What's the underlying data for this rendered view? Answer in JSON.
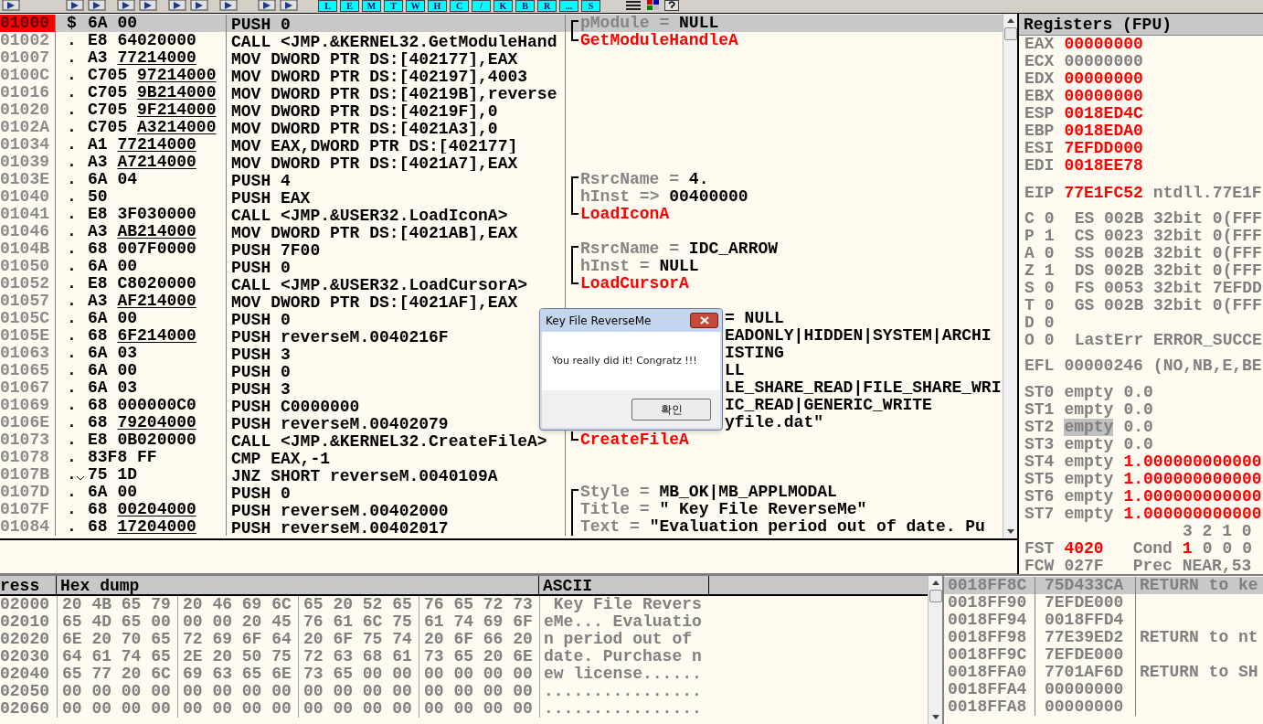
{
  "toolbar": {
    "buttons": [
      "L",
      "E",
      "M",
      "T",
      "W",
      "H",
      "C",
      "/",
      "K",
      "B",
      "R",
      "...",
      "S"
    ]
  },
  "disassembly": {
    "rows": [
      {
        "address": "01000",
        "marker": "$",
        "jump": false,
        "opcode": "6A",
        "operand": "00",
        "underlined": false,
        "instruction": "PUSH 0",
        "selected": true,
        "comment": {
          "kind": "param",
          "opens_group": true,
          "closes_group": false,
          "name": "pModule",
          "op": "=",
          "value": "NULL"
        }
      },
      {
        "address": "01002",
        "marker": ".",
        "jump": false,
        "opcode": "E8",
        "operand": "64020000",
        "underlined": false,
        "instruction": "CALL <JMP.&KERNEL32.GetModuleHand",
        "selected": false,
        "comment": {
          "kind": "call",
          "opens_group": false,
          "closes_group": true,
          "text": "GetModuleHandleA"
        }
      },
      {
        "address": "01007",
        "marker": ".",
        "jump": false,
        "opcode": "A3",
        "operand": "77214000",
        "underlined": true,
        "instruction": "MOV DWORD PTR DS:[402177],EAX",
        "selected": false
      },
      {
        "address": "0100C",
        "marker": ".",
        "jump": false,
        "opcode": "C705",
        "operand": "97214000",
        "underlined": true,
        "instruction": "MOV DWORD PTR DS:[402197],4003",
        "selected": false
      },
      {
        "address": "01016",
        "marker": ".",
        "jump": false,
        "opcode": "C705",
        "operand": "9B214000",
        "underlined": true,
        "instruction": "MOV DWORD PTR DS:[40219B],reverse",
        "selected": false
      },
      {
        "address": "01020",
        "marker": ".",
        "jump": false,
        "opcode": "C705",
        "operand": "9F214000",
        "underlined": true,
        "instruction": "MOV DWORD PTR DS:[40219F],0",
        "selected": false
      },
      {
        "address": "0102A",
        "marker": ".",
        "jump": false,
        "opcode": "C705",
        "operand": "A3214000",
        "underlined": true,
        "instruction": "MOV DWORD PTR DS:[4021A3],0",
        "selected": false
      },
      {
        "address": "01034",
        "marker": ".",
        "jump": false,
        "opcode": "A1",
        "operand": "77214000",
        "underlined": true,
        "instruction": "MOV EAX,DWORD PTR DS:[402177]",
        "selected": false
      },
      {
        "address": "01039",
        "marker": ".",
        "jump": false,
        "opcode": "A3",
        "operand": "A7214000",
        "underlined": true,
        "instruction": "MOV DWORD PTR DS:[4021A7],EAX",
        "selected": false
      },
      {
        "address": "0103E",
        "marker": ".",
        "jump": false,
        "opcode": "6A",
        "operand": "04",
        "underlined": false,
        "instruction": "PUSH 4",
        "selected": false,
        "comment": {
          "kind": "param",
          "opens_group": true,
          "closes_group": false,
          "name": "RsrcName",
          "op": "=",
          "value": "4."
        }
      },
      {
        "address": "01040",
        "marker": ".",
        "jump": false,
        "opcode": "50",
        "operand": "",
        "underlined": false,
        "instruction": "PUSH EAX",
        "selected": false,
        "comment": {
          "kind": "param",
          "opens_group": false,
          "closes_group": false,
          "name": "hInst",
          "op": "=>",
          "value": "00400000"
        }
      },
      {
        "address": "01041",
        "marker": ".",
        "jump": false,
        "opcode": "E8",
        "operand": "3F030000",
        "underlined": false,
        "instruction": "CALL <JMP.&USER32.LoadIconA>",
        "selected": false,
        "comment": {
          "kind": "call",
          "opens_group": false,
          "closes_group": true,
          "text": "LoadIconA"
        }
      },
      {
        "address": "01046",
        "marker": ".",
        "jump": false,
        "opcode": "A3",
        "operand": "AB214000",
        "underlined": true,
        "instruction": "MOV DWORD PTR DS:[4021AB],EAX",
        "selected": false
      },
      {
        "address": "0104B",
        "marker": ".",
        "jump": false,
        "opcode": "68",
        "operand": "007F0000",
        "underlined": false,
        "instruction": "PUSH 7F00",
        "selected": false,
        "comment": {
          "kind": "param",
          "opens_group": true,
          "closes_group": false,
          "name": "RsrcName",
          "op": "=",
          "value": "IDC_ARROW"
        }
      },
      {
        "address": "01050",
        "marker": ".",
        "jump": false,
        "opcode": "6A",
        "operand": "00",
        "underlined": false,
        "instruction": "PUSH 0",
        "selected": false,
        "comment": {
          "kind": "param",
          "opens_group": false,
          "closes_group": false,
          "name": "hInst",
          "op": "=",
          "value": "NULL"
        }
      },
      {
        "address": "01052",
        "marker": ".",
        "jump": false,
        "opcode": "E8",
        "operand": "C8020000",
        "underlined": false,
        "instruction": "CALL <JMP.&USER32.LoadCursorA>",
        "selected": false,
        "comment": {
          "kind": "call",
          "opens_group": false,
          "closes_group": true,
          "text": "LoadCursorA"
        }
      },
      {
        "address": "01057",
        "marker": ".",
        "jump": false,
        "opcode": "A3",
        "operand": "AF214000",
        "underlined": true,
        "instruction": "MOV DWORD PTR DS:[4021AF],EAX",
        "selected": false
      },
      {
        "address": "0105C",
        "marker": ".",
        "jump": false,
        "opcode": "6A",
        "operand": "00",
        "underlined": false,
        "instruction": "PUSH 0",
        "selected": false,
        "comment": {
          "kind": "partial",
          "text": "= NULL"
        }
      },
      {
        "address": "0105E",
        "marker": ".",
        "jump": false,
        "opcode": "68",
        "operand": "6F214000",
        "underlined": true,
        "instruction": "PUSH reverseM.0040216F",
        "selected": false,
        "comment": {
          "kind": "partial",
          "text": "EADONLY|HIDDEN|SYSTEM|ARCHI"
        }
      },
      {
        "address": "01063",
        "marker": ".",
        "jump": false,
        "opcode": "6A",
        "operand": "03",
        "underlined": false,
        "instruction": "PUSH 3",
        "selected": false,
        "comment": {
          "kind": "partial",
          "text": "ISTING"
        }
      },
      {
        "address": "01065",
        "marker": ".",
        "jump": false,
        "opcode": "6A",
        "operand": "00",
        "underlined": false,
        "instruction": "PUSH 0",
        "selected": false,
        "comment": {
          "kind": "partial",
          "text": "LL"
        }
      },
      {
        "address": "01067",
        "marker": ".",
        "jump": false,
        "opcode": "6A",
        "operand": "03",
        "underlined": false,
        "instruction": "PUSH 3",
        "selected": false,
        "comment": {
          "kind": "partial",
          "text": "LE_SHARE_READ|FILE_SHARE_WRI"
        }
      },
      {
        "address": "01069",
        "marker": ".",
        "jump": false,
        "opcode": "68",
        "operand": "000000C0",
        "underlined": false,
        "instruction": "PUSH C0000000",
        "selected": false,
        "comment": {
          "kind": "partial",
          "text": "IC_READ|GENERIC_WRITE"
        }
      },
      {
        "address": "0106E",
        "marker": ".",
        "jump": false,
        "opcode": "68",
        "operand": "79204000",
        "underlined": true,
        "instruction": "PUSH reverseM.00402079",
        "selected": false,
        "comment": {
          "kind": "partial",
          "text": "yfile.dat\""
        }
      },
      {
        "address": "01073",
        "marker": ".",
        "jump": false,
        "opcode": "E8",
        "operand": "0B020000",
        "underlined": false,
        "instruction": "CALL <JMP.&KERNEL32.CreateFileA>",
        "selected": false,
        "comment": {
          "kind": "call",
          "opens_group": false,
          "closes_group": true,
          "text": "CreateFileA"
        }
      },
      {
        "address": "01078",
        "marker": ".",
        "jump": false,
        "opcode": "83F8",
        "operand": "FF",
        "underlined": false,
        "instruction": "CMP EAX,-1",
        "selected": false
      },
      {
        "address": "0107B",
        "marker": ".",
        "jump": true,
        "opcode": "75",
        "operand": "1D",
        "underlined": false,
        "instruction": "JNZ SHORT reverseM.0040109A",
        "selected": false
      },
      {
        "address": "0107D",
        "marker": ".",
        "jump": false,
        "opcode": "6A",
        "operand": "00",
        "underlined": false,
        "instruction": "PUSH 0",
        "selected": false,
        "comment": {
          "kind": "param",
          "opens_group": true,
          "closes_group": false,
          "name": "Style",
          "op": "=",
          "value": "MB_OK|MB_APPLMODAL"
        }
      },
      {
        "address": "0107F",
        "marker": ".",
        "jump": false,
        "opcode": "68",
        "operand": "00204000",
        "underlined": true,
        "instruction": "PUSH reverseM.00402000",
        "selected": false,
        "comment": {
          "kind": "param",
          "opens_group": false,
          "closes_group": false,
          "name": "Title",
          "op": "=",
          "value": "\" Key File ReverseMe\""
        }
      },
      {
        "address": "01084",
        "marker": ".",
        "jump": false,
        "opcode": "68",
        "operand": "17204000",
        "underlined": true,
        "instruction": "PUSH reverseM.00402017",
        "selected": false,
        "comment": {
          "kind": "param",
          "opens_group": false,
          "closes_group": false,
          "name": "Text",
          "op": "=",
          "value": "\"Evaluation period out of date. Pu"
        }
      }
    ]
  },
  "registers": {
    "title": "Registers (FPU)",
    "general": [
      {
        "name": "EAX",
        "value": "00000000",
        "changed": true
      },
      {
        "name": "ECX",
        "value": "00000000",
        "changed": false
      },
      {
        "name": "EDX",
        "value": "00000000",
        "changed": true
      },
      {
        "name": "EBX",
        "value": "00000000",
        "changed": true
      },
      {
        "name": "ESP",
        "value": "0018ED4C",
        "changed": true
      },
      {
        "name": "EBP",
        "value": "0018EDA0",
        "changed": true
      },
      {
        "name": "ESI",
        "value": "7EFDD000",
        "changed": true
      },
      {
        "name": "EDI",
        "value": "0018EE78",
        "changed": true
      }
    ],
    "eip": {
      "name": "EIP",
      "value": "77E1FC52",
      "changed": true,
      "detail": "ntdll.77E1F"
    },
    "flags": [
      {
        "flag": "C",
        "bit": "0",
        "detail": "ES 002B 32bit 0(FFF"
      },
      {
        "flag": "P",
        "bit": "1",
        "detail": "CS 0023 32bit 0(FFF"
      },
      {
        "flag": "A",
        "bit": "0",
        "detail": "SS 002B 32bit 0(FFF"
      },
      {
        "flag": "Z",
        "bit": "1",
        "detail": "DS 002B 32bit 0(FFF"
      },
      {
        "flag": "S",
        "bit": "0",
        "detail": "FS 0053 32bit 7EFDD"
      },
      {
        "flag": "T",
        "bit": "0",
        "detail": "GS 002B 32bit 0(FFF"
      },
      {
        "flag": "D",
        "bit": "0"
      },
      {
        "flag": "O",
        "bit": "0",
        "detail": "LastErr ERROR_SUCCE"
      }
    ],
    "efl": {
      "name": "EFL",
      "value": "00000246",
      "detail": "(NO,NB,E,BE"
    },
    "fpu": [
      {
        "name": "ST0",
        "tag": "empty",
        "value": "0.0",
        "changed": false,
        "selected": false
      },
      {
        "name": "ST1",
        "tag": "empty",
        "value": "0.0",
        "changed": false,
        "selected": false
      },
      {
        "name": "ST2",
        "tag": "empty",
        "value": "0.0",
        "changed": false,
        "selected": true
      },
      {
        "name": "ST3",
        "tag": "empty",
        "value": "0.0",
        "changed": false,
        "selected": false
      },
      {
        "name": "ST4",
        "tag": "empty",
        "value": "1.000000000000",
        "changed": true,
        "selected": false
      },
      {
        "name": "ST5",
        "tag": "empty",
        "value": "1.000000000000",
        "changed": true,
        "selected": false
      },
      {
        "name": "ST6",
        "tag": "empty",
        "value": "1.000000000000",
        "changed": true,
        "selected": false
      },
      {
        "name": "ST7",
        "tag": "empty",
        "value": "1.000000000000",
        "changed": true,
        "selected": false
      }
    ],
    "cond_bits": "3 2 1 0",
    "fst": {
      "name": "FST",
      "value": "4020",
      "changed": true,
      "cond_label": "Cond",
      "cond": [
        {
          "bit": "1",
          "changed": true
        },
        {
          "bit": "0",
          "changed": false
        },
        {
          "bit": "0",
          "changed": false
        },
        {
          "bit": "0",
          "changed": false
        }
      ]
    },
    "fcw": {
      "name": "FCW",
      "value": "027F",
      "detail": "Prec NEAR,53"
    }
  },
  "dump": {
    "columns": [
      "ress",
      "Hex dump",
      "ASCII"
    ],
    "rows": [
      {
        "address": "02000",
        "groups": [
          "20 4B 65 79",
          "20 46 69 6C",
          "65 20 52 65",
          "76 65 72 73"
        ],
        "ascii": " Key File Revers"
      },
      {
        "address": "02010",
        "groups": [
          "65 4D 65 00",
          "00 00 20 45",
          "76 61 6C 75",
          "61 74 69 6F"
        ],
        "ascii": "eMe... Evaluatio"
      },
      {
        "address": "02020",
        "groups": [
          "6E 20 70 65",
          "72 69 6F 64",
          "20 6F 75 74",
          "20 6F 66 20"
        ],
        "ascii": "n period out of"
      },
      {
        "address": "02030",
        "groups": [
          "64 61 74 65",
          "2E 20 50 75",
          "72 63 68 61",
          "73 65 20 6E"
        ],
        "ascii": "date. Purchase n"
      },
      {
        "address": "02040",
        "groups": [
          "65 77 20 6C",
          "69 63 65 6E",
          "73 65 00 00",
          "00 00 00 00"
        ],
        "ascii": "ew license......"
      },
      {
        "address": "02050",
        "groups": [
          "00 00 00 00",
          "00 00 00 00",
          "00 00 00 00",
          "00 00 00 00"
        ],
        "ascii": "................"
      },
      {
        "address": "02060",
        "groups": [
          "00 00 00 00",
          "00 00 00 00",
          "00 00 00 00",
          "00 00 00 00"
        ],
        "ascii": "................"
      }
    ]
  },
  "stack": {
    "rows": [
      {
        "address": "0018FF8C",
        "value": "75D433CA",
        "comment": "RETURN to ke",
        "selected": true
      },
      {
        "address": "0018FF90",
        "value": "7EFDE000",
        "selected": false
      },
      {
        "address": "0018FF94",
        "value": "0018FFD4",
        "selected": false
      },
      {
        "address": "0018FF98",
        "value": "77E39ED2",
        "comment": "RETURN to nt",
        "selected": false
      },
      {
        "address": "0018FF9C",
        "value": "7EFDE000",
        "selected": false
      },
      {
        "address": "0018FFA0",
        "value": "7701AF6D",
        "comment": "RETURN to SH",
        "selected": false
      },
      {
        "address": "0018FFA4",
        "value": "00000000",
        "selected": false
      },
      {
        "address": "0018FFA8",
        "value": "00000000",
        "selected": false
      }
    ]
  },
  "dialog": {
    "title": "Key File ReverseMe",
    "message": "You really did it! Congratz !!!",
    "button": "확인"
  }
}
